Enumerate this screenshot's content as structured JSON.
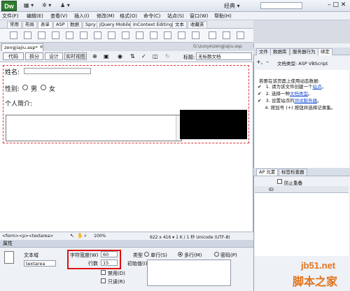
{
  "app": {
    "logo": "Dw",
    "workspace": "经典 ▾",
    "toolbar_icons": [
      "layout-icon",
      "gear-icon",
      "user-icon"
    ]
  },
  "menu": [
    "文件(F)",
    "编辑(E)",
    "查看(V)",
    "插入(I)",
    "修改(M)",
    "格式(O)",
    "命令(C)",
    "站点(S)",
    "窗口(W)",
    "帮助(H)"
  ],
  "insert_tabs": [
    "常用",
    "布局",
    "表单",
    "ASP",
    "数据",
    "Spry",
    "jQuery Mobile",
    "InContext Editing",
    "文本",
    "收藏夹"
  ],
  "document": {
    "tab": "zengjiajiu.asp*",
    "path": "G:\\zuoye\\zengjiajiu.asp",
    "views": [
      "代码",
      "拆分",
      "设计",
      "实时视图"
    ],
    "title_label": "标题:",
    "title_value": "无标题文档"
  },
  "form": {
    "name_label": "姓名:",
    "gender_label": "性别:",
    "male": "男",
    "female": "女",
    "intro_label": "个人简介:"
  },
  "status": {
    "tag_path": "<form><p><textarea>",
    "zoom": "100%",
    "info": "622 x 416 ▾ 1 K / 1 秒 Unicode (UTF-8)"
  },
  "props": {
    "header": "属性",
    "field_type": "文本域",
    "field_name": "textarea",
    "char_width_label": "字符宽度(W)",
    "char_width": "60",
    "rows_label": "行数",
    "rows": "15",
    "init_label": "初始值(I)",
    "type_label": "类型",
    "single": "单行(S)",
    "multi": "多行(M)",
    "password": "密码(P)",
    "disabled": "禁用(D)",
    "readonly": "只读(R)"
  },
  "right": {
    "tabs": [
      "文件",
      "数据库",
      "服务器行为",
      "绑定"
    ],
    "doc_type": "文档类型: ASP VBScript",
    "intro": "若要在该页面上使用动态数据:",
    "steps": [
      {
        "num": "1.",
        "text": "请为该文件创建一个",
        "link": "站点",
        "end": "。"
      },
      {
        "num": "2.",
        "text": "选择一种",
        "link": "文档类型",
        "end": "。"
      },
      {
        "num": "3.",
        "text": "设置站点的",
        "link": "测试服务器",
        "end": "。"
      },
      {
        "num": "4.",
        "text": "按加号 (+) 按钮并选择记录集。",
        "link": "",
        "end": ""
      }
    ],
    "ap_tabs": [
      "AP 元素",
      "标签检查器"
    ],
    "prevent_overlap": "防止重叠",
    "id_col": "ID"
  },
  "watermark": {
    "line1": "jb51.net",
    "line2": "脚本之家"
  }
}
